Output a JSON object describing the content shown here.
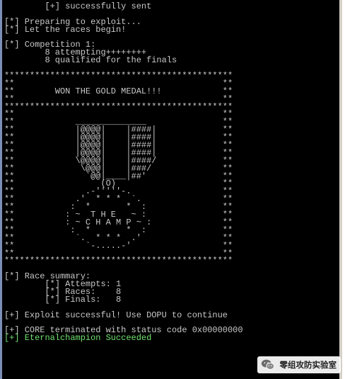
{
  "terminal": {
    "lines": [
      {
        "text": "        [+] successfully sent"
      },
      {
        "text": ""
      },
      {
        "text": "[*] Preparing to exploit..."
      },
      {
        "text": "[*] Let the races begin!"
      },
      {
        "text": ""
      },
      {
        "text": "[*] Competition 1:"
      },
      {
        "text": "        8 attempting++++++++"
      },
      {
        "text": "        8 qualified for the finals"
      },
      {
        "text": ""
      },
      {
        "text": "*********************************************"
      },
      {
        "text": "**                                         **"
      },
      {
        "text": "**        WON THE GOLD MEDAL!!!            **"
      },
      {
        "text": "**                                         **"
      },
      {
        "text": "*********************************************"
      },
      {
        "text": "**                                         **"
      },
      {
        "text": "**            ______________               **"
      },
      {
        "text": "**            |@@@@|    |####|             **"
      },
      {
        "text": "**            |@@@@|    |####|             **"
      },
      {
        "text": "**            |@@@@|    |####|             **"
      },
      {
        "text": "**            |@@@@|    |####|             **"
      },
      {
        "text": "**            \\@@@@|    |####/             **"
      },
      {
        "text": "**             \\@@@|    |###/              **"
      },
      {
        "text": "**              `@@|____|##'               **"
      },
      {
        "text": "**                 (O)                     **"
      },
      {
        "text": "**              .-'''''-.                  **"
      },
      {
        "text": "**            .'  * * *  `.                **"
      },
      {
        "text": "**           :  *       *  :               **"
      },
      {
        "text": "**          : ~  T H E   ~ :               **"
      },
      {
        "text": "**          : ~ C H A M P ~ :              **"
      },
      {
        "text": "**           :  *       *  :               **"
      },
      {
        "text": "**            `.  * * *  .'                **"
      },
      {
        "text": "**              `-.....-'                  **"
      },
      {
        "text": "**                                         **"
      },
      {
        "text": "*********************************************"
      },
      {
        "text": ""
      },
      {
        "text": "[*] Race summary:"
      },
      {
        "text": "        [*] Attempts: 1"
      },
      {
        "text": "        [*] Races:    8"
      },
      {
        "text": "        [*] Finals:   8"
      },
      {
        "text": ""
      },
      {
        "text": "[+] Exploit successful! Use DOPU to continue"
      },
      {
        "text": ""
      },
      {
        "text": "[+] CORE terminated with status code 0x00000000"
      },
      {
        "text": "[+] Eternalchampion Succeeded"
      }
    ],
    "colors": {
      "background": "#000000",
      "text": "#c8c8c8",
      "success": "#6fe36f"
    }
  },
  "watermark": {
    "text": "零组攻防实验室",
    "icon": "wechat-icon"
  }
}
